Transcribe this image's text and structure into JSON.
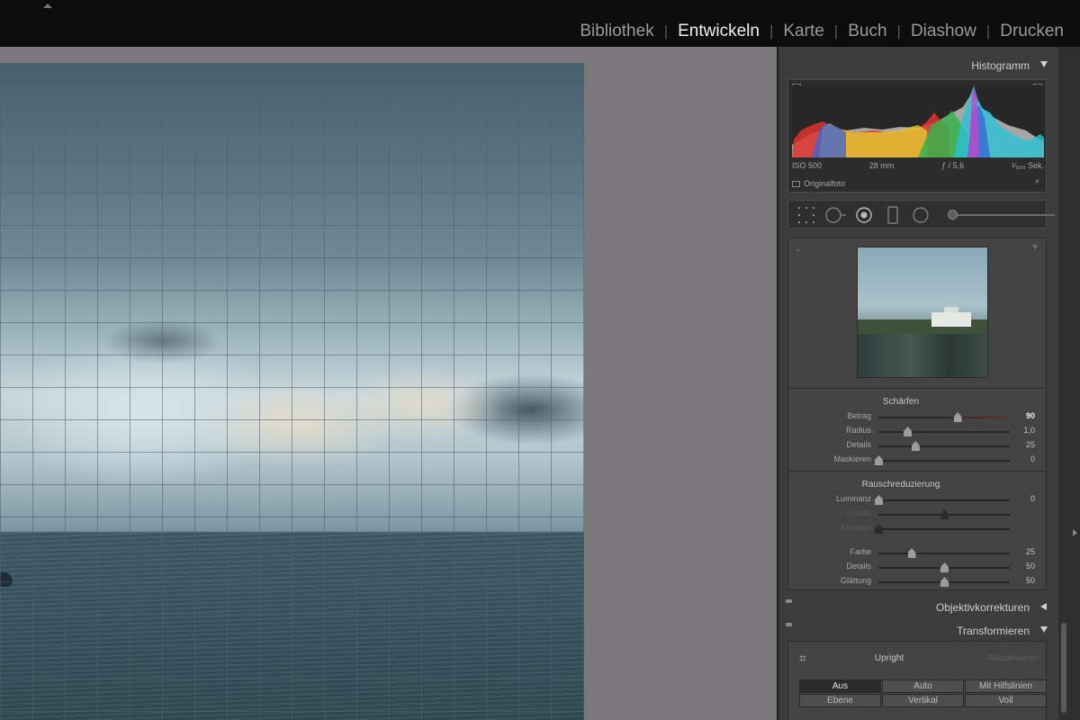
{
  "window": {
    "modules": [
      {
        "label": "Bibliothek",
        "active": false
      },
      {
        "label": "Entwickeln",
        "active": true
      },
      {
        "label": "Karte",
        "active": false
      },
      {
        "label": "Buch",
        "active": false
      },
      {
        "label": "Diashow",
        "active": false
      },
      {
        "label": "Drucken",
        "active": false
      }
    ],
    "separator": "|"
  },
  "histogram": {
    "title": "Histogramm",
    "iso": "ISO 500",
    "focal": "28 mm",
    "aperture": "ƒ / 5,6",
    "shutter": "¹⁄₆₀₀ Sek.",
    "original_label": "Originalfoto",
    "flash_icon": "bolt-icon"
  },
  "detail": {
    "sharpen": {
      "title": "Schärfen",
      "sliders": [
        {
          "label": "Betrag",
          "value": "90",
          "fraction": 0.6
        },
        {
          "label": "Radius",
          "value": "1,0",
          "fraction": 0.22
        },
        {
          "label": "Details",
          "value": "25",
          "fraction": 0.28
        },
        {
          "label": "Maskieren",
          "value": "0",
          "fraction": 0.0
        }
      ]
    },
    "noise": {
      "title": "Rauschreduzierung",
      "sliders": [
        {
          "label": "Luminanz",
          "value": "0",
          "fraction": 0.0,
          "dim": false
        },
        {
          "label": "Details",
          "value": "",
          "fraction": 0.5,
          "dim": true
        },
        {
          "label": "Kontrast",
          "value": "",
          "fraction": 0.0,
          "dim": true
        },
        {
          "label": "Farbe",
          "value": "25",
          "fraction": 0.25,
          "dim": false
        },
        {
          "label": "Details",
          "value": "50",
          "fraction": 0.5,
          "dim": false
        },
        {
          "label": "Glättung",
          "value": "50",
          "fraction": 0.5,
          "dim": false
        }
      ]
    }
  },
  "lens": {
    "title": "Objektivkorrekturen"
  },
  "transform": {
    "title": "Transformieren",
    "upright_label": "Upright",
    "update_label": "Aktualisieren",
    "buttons": [
      "Aus",
      "Auto",
      "Mit Hilfslinien",
      "Ebene",
      "Vertikal",
      "Voll"
    ],
    "active_button": "Aus"
  },
  "colors": {
    "active_module": "#f2f2f2",
    "inactive_module": "#9a9a9a",
    "panel_bg": "#3c3c3c",
    "canvas_bg": "#7a787b"
  }
}
